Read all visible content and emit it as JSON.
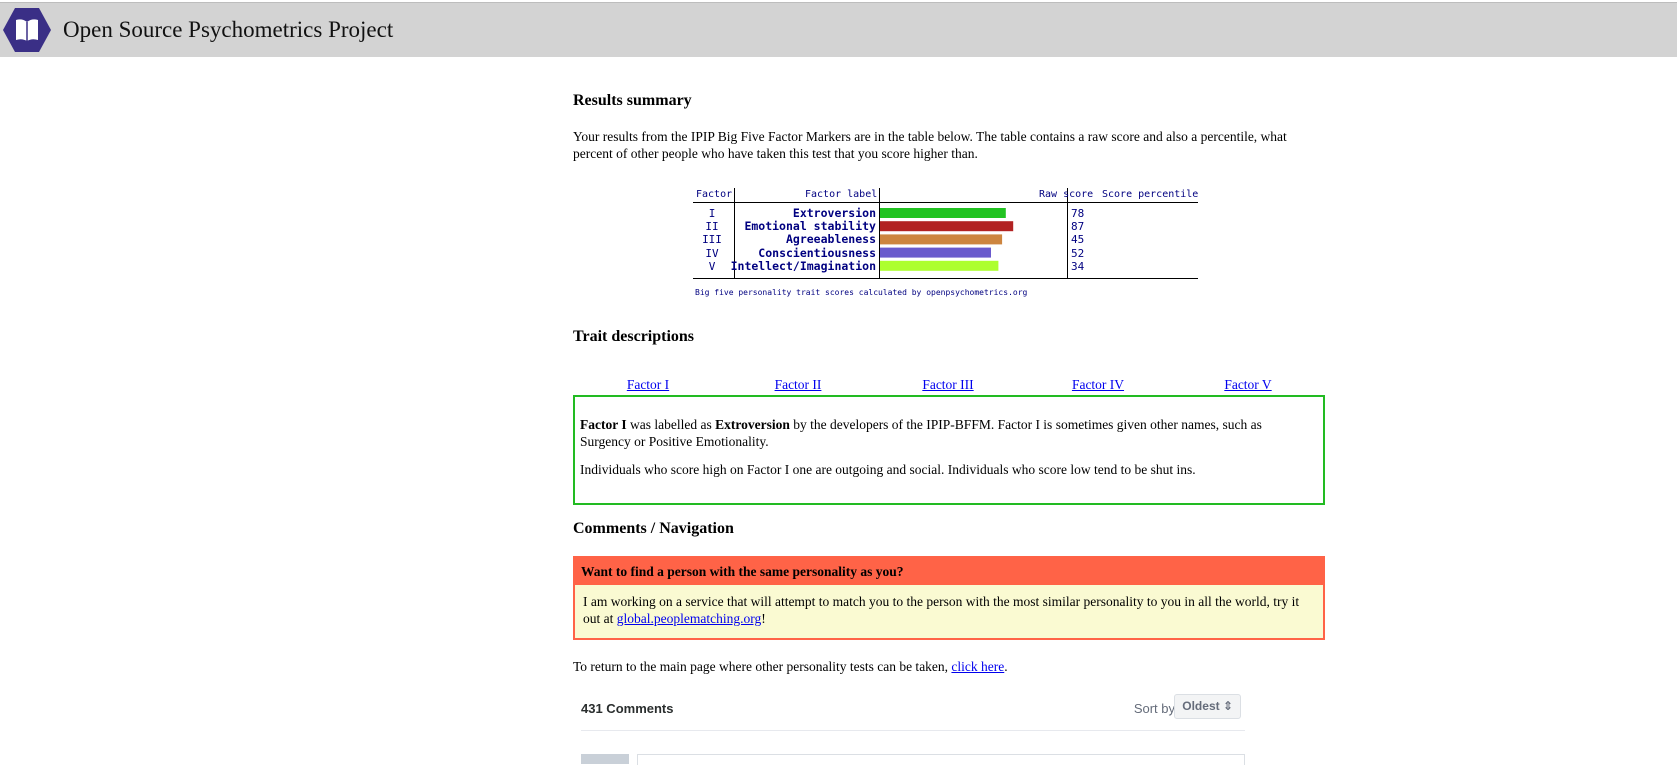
{
  "header": {
    "site_title": "Open Source Psychometrics Project",
    "logo_bg": "#3a2f86"
  },
  "results": {
    "heading": "Results summary",
    "intro": "Your results from the IPIP Big Five Factor Markers are in the table below. The table contains a raw score and also a percentile, what percent of other people who have taken this test that you score higher than."
  },
  "chart_data": {
    "type": "bar",
    "columns": [
      "Factor",
      "Factor label",
      "Raw score",
      "Score percentile"
    ],
    "factors": [
      "I",
      "II",
      "III",
      "IV",
      "V"
    ],
    "categories": [
      "Extroversion",
      "Emotional stability",
      "Agreeableness",
      "Conscientiousness",
      "Intellect/Imagination"
    ],
    "values": [
      34,
      36,
      33,
      30,
      32
    ],
    "xlim": [
      0,
      50
    ],
    "percentiles": [
      "78",
      "87",
      "45",
      "52",
      "34"
    ],
    "colors": [
      "#22c322",
      "#b22222",
      "#cd853f",
      "#6a5acd",
      "#adff2f"
    ],
    "caption": "Big five personality trait scores calculated by openpsychometrics.org"
  },
  "traits": {
    "heading": "Trait descriptions",
    "tabs": [
      "Factor I",
      "Factor II",
      "Factor III",
      "Factor IV",
      "Factor V"
    ],
    "active_tab": 0,
    "panel_factor": "Factor I",
    "panel_text_1": " was labelled as ",
    "panel_label": "Extroversion",
    "panel_text_2": " by the developers of the IPIP-BFFM. Factor I is sometimes given other names, such as Surgency or Positive Emotionality.",
    "panel_para2": "Individuals who score high on Factor I one are outgoing and social. Individuals who score low tend to be shut ins.",
    "accent": "#22bb22"
  },
  "nav": {
    "heading": "Comments / Navigation",
    "promo_title": "Want to find a person with the same personality as you?",
    "promo_text": "I am working on a service that will attempt to match you to the person with the most similar personality to you in all the world, try it out at ",
    "promo_link": "global.peoplematching.org",
    "promo_end": "!",
    "return_text": "To return to the main page where other personality tests can be taken, ",
    "return_link": "click here",
    "return_end": "."
  },
  "comments": {
    "count_label": "431 Comments",
    "sort_label": "Sort by",
    "sort_value": "Oldest ⇕"
  }
}
